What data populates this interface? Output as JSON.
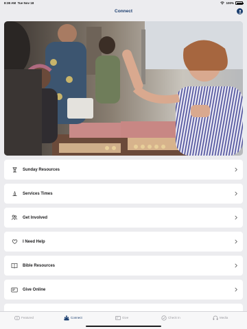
{
  "status_bar": {
    "time": "8:38 AM",
    "date": "Tue Nov 18",
    "battery": "100%",
    "battery_level": 1.0
  },
  "nav": {
    "title": "Connect"
  },
  "hero": {
    "alt": "photo"
  },
  "menu_items": [
    {
      "label": "Sunday Resources",
      "icon": "podium-icon"
    },
    {
      "label": "Services Times",
      "icon": "candle-icon"
    },
    {
      "label": "Get Involved",
      "icon": "people-icon"
    },
    {
      "label": "I Need Help",
      "icon": "heart-icon"
    },
    {
      "label": "Bible Resources",
      "icon": "book-icon"
    },
    {
      "label": "Give Online",
      "icon": "card-icon"
    }
  ],
  "tabs": [
    {
      "label": "Featured",
      "icon": "featured-icon",
      "active": false
    },
    {
      "label": "Connect",
      "icon": "connect-icon",
      "active": true
    },
    {
      "label": "Give",
      "icon": "give-icon",
      "active": false
    },
    {
      "label": "Check In",
      "icon": "check-icon",
      "active": false
    },
    {
      "label": "Media",
      "icon": "headphones-icon",
      "active": false
    }
  ],
  "colors": {
    "accent": "#1a3d6e",
    "background": "#ececef",
    "card": "#ffffff",
    "inactive": "#9a9aa0"
  }
}
